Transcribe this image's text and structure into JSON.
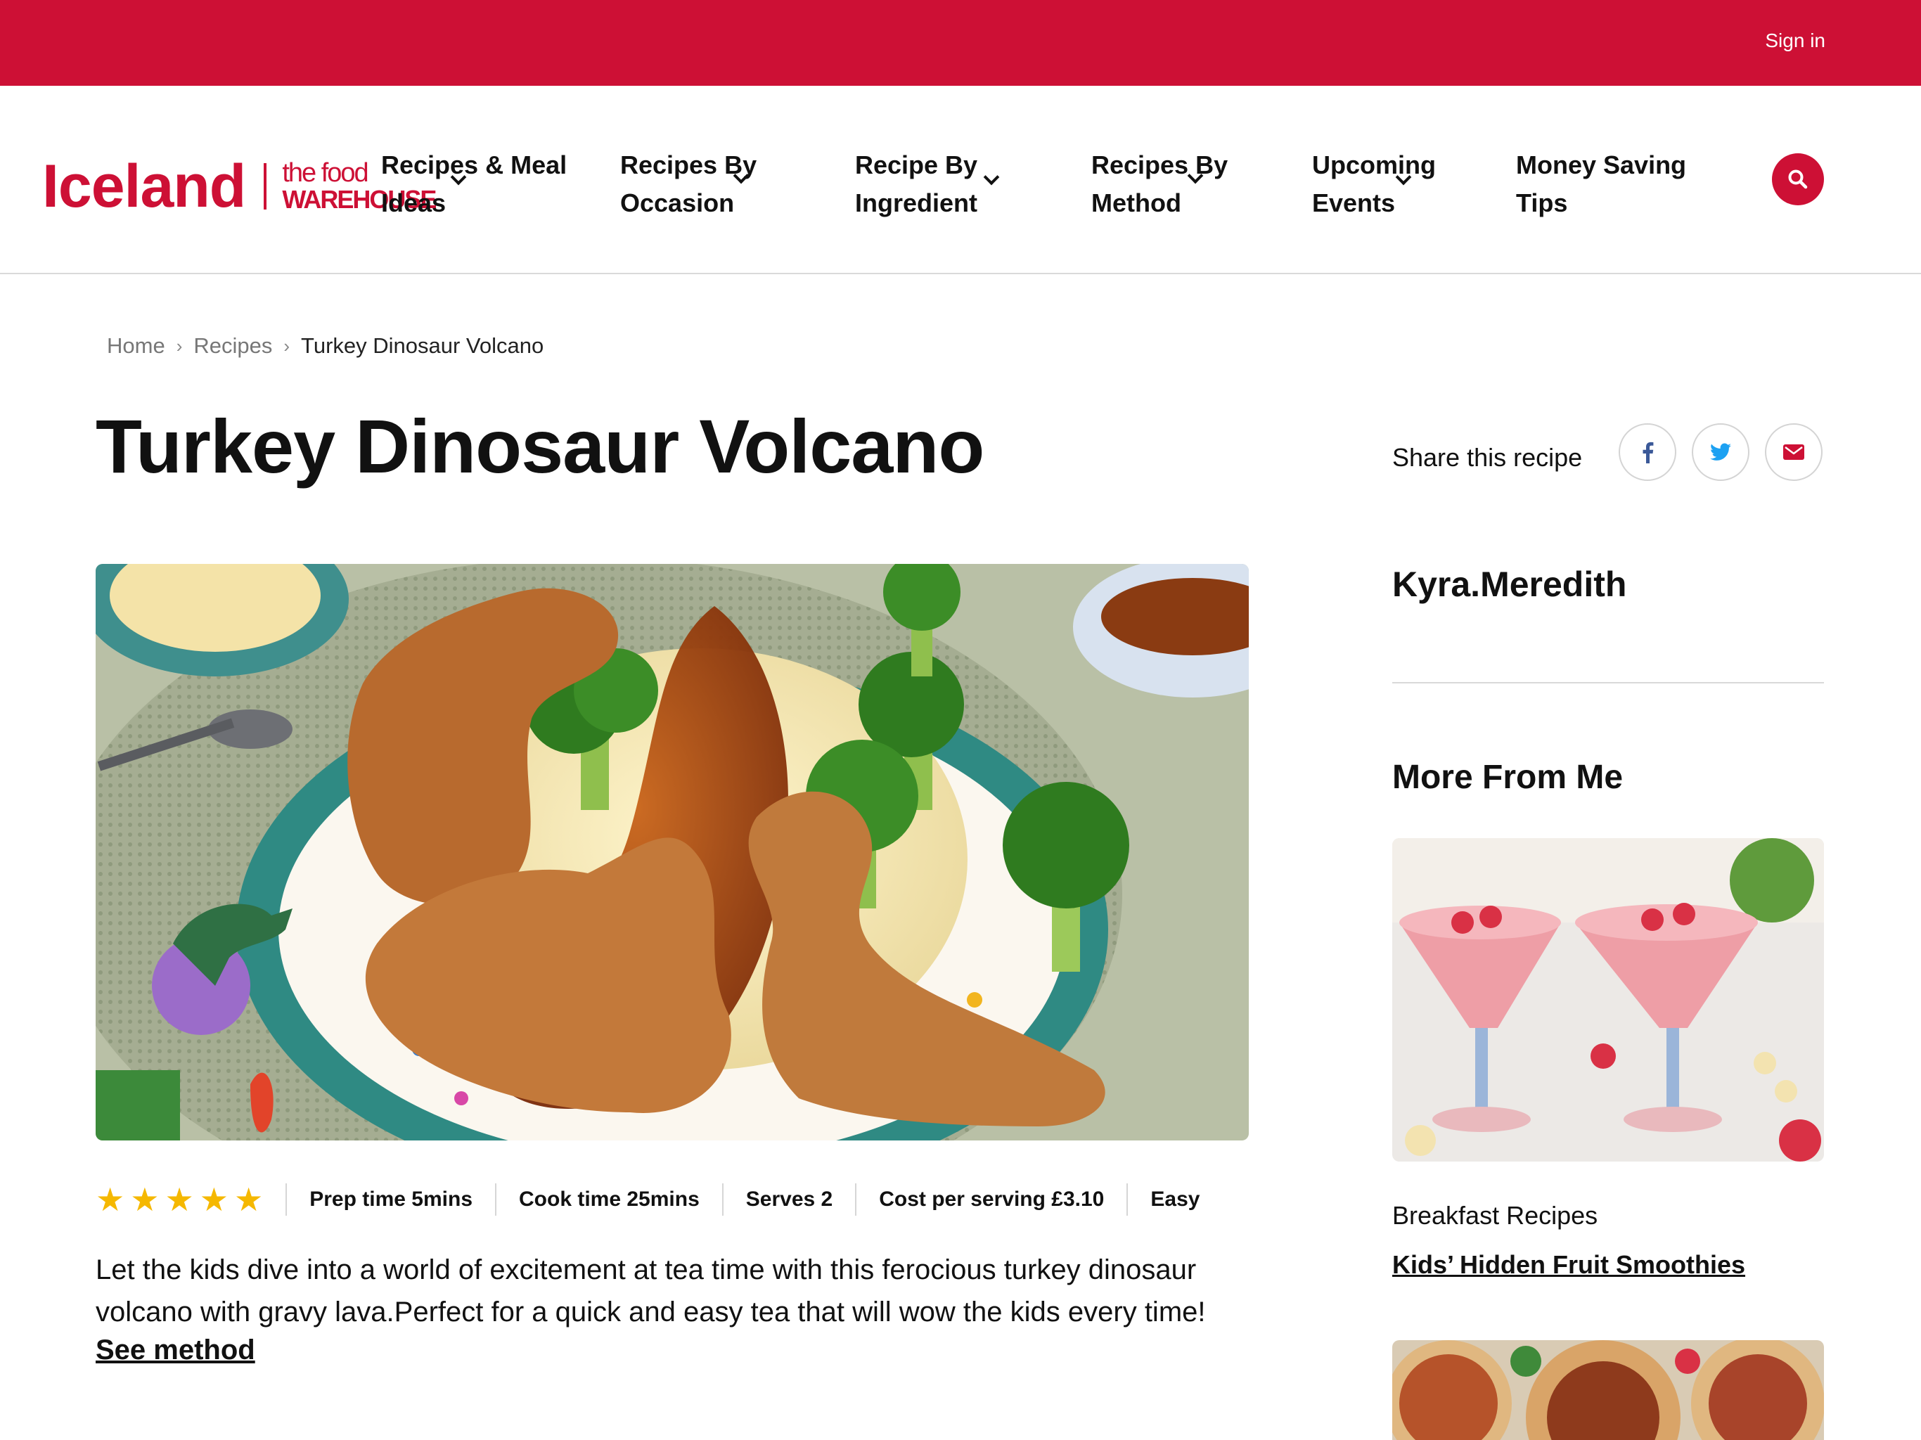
{
  "topbar": {
    "sign_in": "Sign in",
    "brand_color": "#cd1035"
  },
  "logo": {
    "primary": "Iceland",
    "secondary_line1": "the food",
    "secondary_line2": "WAREHOUSE"
  },
  "nav": {
    "items": [
      {
        "line1": "Recipes & Meal",
        "line2": "Ideas"
      },
      {
        "line1": "Recipes By",
        "line2": "Occasion"
      },
      {
        "line1": "Recipe By",
        "line2": "Ingredient"
      },
      {
        "line1": "Recipes By",
        "line2": "Method"
      },
      {
        "line1": "Upcoming",
        "line2": "Events"
      },
      {
        "line1": "Money Saving",
        "line2": "Tips"
      }
    ],
    "search_icon": "search-icon"
  },
  "breadcrumb": {
    "home": "Home",
    "recipes": "Recipes",
    "current": "Turkey Dinosaur Volcano"
  },
  "recipe": {
    "title": "Turkey Dinosaur Volcano",
    "rating": 5,
    "prep": "Prep time 5mins",
    "cook": "Cook time 25mins",
    "serves": "Serves 2",
    "cost": "Cost per serving £3.10",
    "difficulty": "Easy",
    "description": "Let the kids dive into a world of excitement at tea time with this ferocious turkey dinosaur volcano with gravy lava.Perfect for a quick and easy tea that will wow the kids every time!",
    "see_method": "See method"
  },
  "share": {
    "label": "Share this recipe",
    "icons": [
      "facebook-icon",
      "twitter-icon",
      "email-icon"
    ],
    "colors": {
      "facebook": "#3b5998",
      "twitter": "#1da1f2",
      "email": "#cd1035"
    }
  },
  "sidebar": {
    "author": "Kyra.Meredith",
    "more_title": "More From Me",
    "card": {
      "category": "Breakfast Recipes",
      "title": "Kids’ Hidden Fruit Smoothies"
    }
  },
  "colors": {
    "star": "#f5b800",
    "accent": "#cd1035"
  }
}
